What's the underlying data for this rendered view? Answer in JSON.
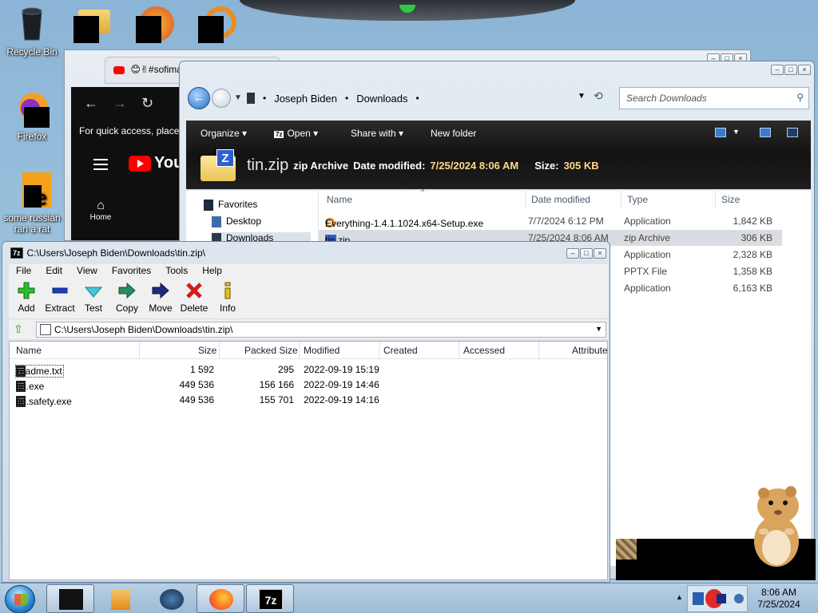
{
  "desktop": {
    "icons": [
      {
        "label": "Recycle Bin"
      },
      {
        "label": "Firefox"
      },
      {
        "label": "some russian ran a rat"
      }
    ]
  },
  "browser": {
    "tab_title": "😊✌#sofima",
    "quick_access_hint": "For quick access, place y",
    "youtube_brand": "YouT",
    "home_label": "Home"
  },
  "explorer": {
    "breadcrumb": [
      "Joseph Biden",
      "Downloads"
    ],
    "search_placeholder": "Search Downloads",
    "toolbar": {
      "organize": "Organize",
      "open": "Open",
      "share_with": "Share with",
      "new_folder": "New folder"
    },
    "details": {
      "file_name": "tin.zip",
      "file_type": "zip Archive",
      "date_label": "Date modified:",
      "date_value": "7/25/2024 8:06 AM",
      "size_label": "Size:",
      "size_value": "305 KB"
    },
    "nav_pane": [
      "Favorites",
      "Desktop",
      "Downloads"
    ],
    "columns": {
      "name": "Name",
      "date": "Date modified",
      "type": "Type",
      "size": "Size"
    },
    "files": [
      {
        "name": "Everything-1.4.1.1024.x64-Setup.exe",
        "date": "7/7/2024 6:12 PM",
        "type": "Application",
        "size": "1,842 KB"
      },
      {
        "name": "tin.zip",
        "date": "7/25/2024 8:06 AM",
        "type": "zip Archive",
        "size": "306 KB"
      },
      {
        "name": "",
        "date": "",
        "type": "Application",
        "size": "2,328 KB"
      },
      {
        "name": "",
        "date": "",
        "type": "PPTX File",
        "size": "1,358 KB"
      },
      {
        "name": "",
        "date": "",
        "type": "Application",
        "size": "6,163 KB"
      }
    ]
  },
  "sevenzip": {
    "title": "C:\\Users\\Joseph Biden\\Downloads\\tin.zip\\",
    "logo": "7z",
    "menu": [
      "File",
      "Edit",
      "View",
      "Favorites",
      "Tools",
      "Help"
    ],
    "tools": [
      "Add",
      "Extract",
      "Test",
      "Copy",
      "Move",
      "Delete",
      "Info"
    ],
    "address": "C:\\Users\\Joseph Biden\\Downloads\\tin.zip\\",
    "columns": [
      "Name",
      "Size",
      "Packed Size",
      "Modified",
      "Created",
      "Accessed",
      "Attribute"
    ],
    "files": [
      {
        "name": "readme.txt",
        "size": "1 592",
        "packed": "295",
        "modified": "2022-09-19 15:19"
      },
      {
        "name": "tin.exe",
        "size": "449 536",
        "packed": "156 166",
        "modified": "2022-09-19 14:46"
      },
      {
        "name": "tin.safety.exe",
        "size": "449 536",
        "packed": "155 701",
        "modified": "2022-09-19 14:16"
      }
    ]
  },
  "taskbar": {
    "time": "8:06 AM",
    "date": "7/25/2024",
    "seven_zip_label": "7z"
  }
}
